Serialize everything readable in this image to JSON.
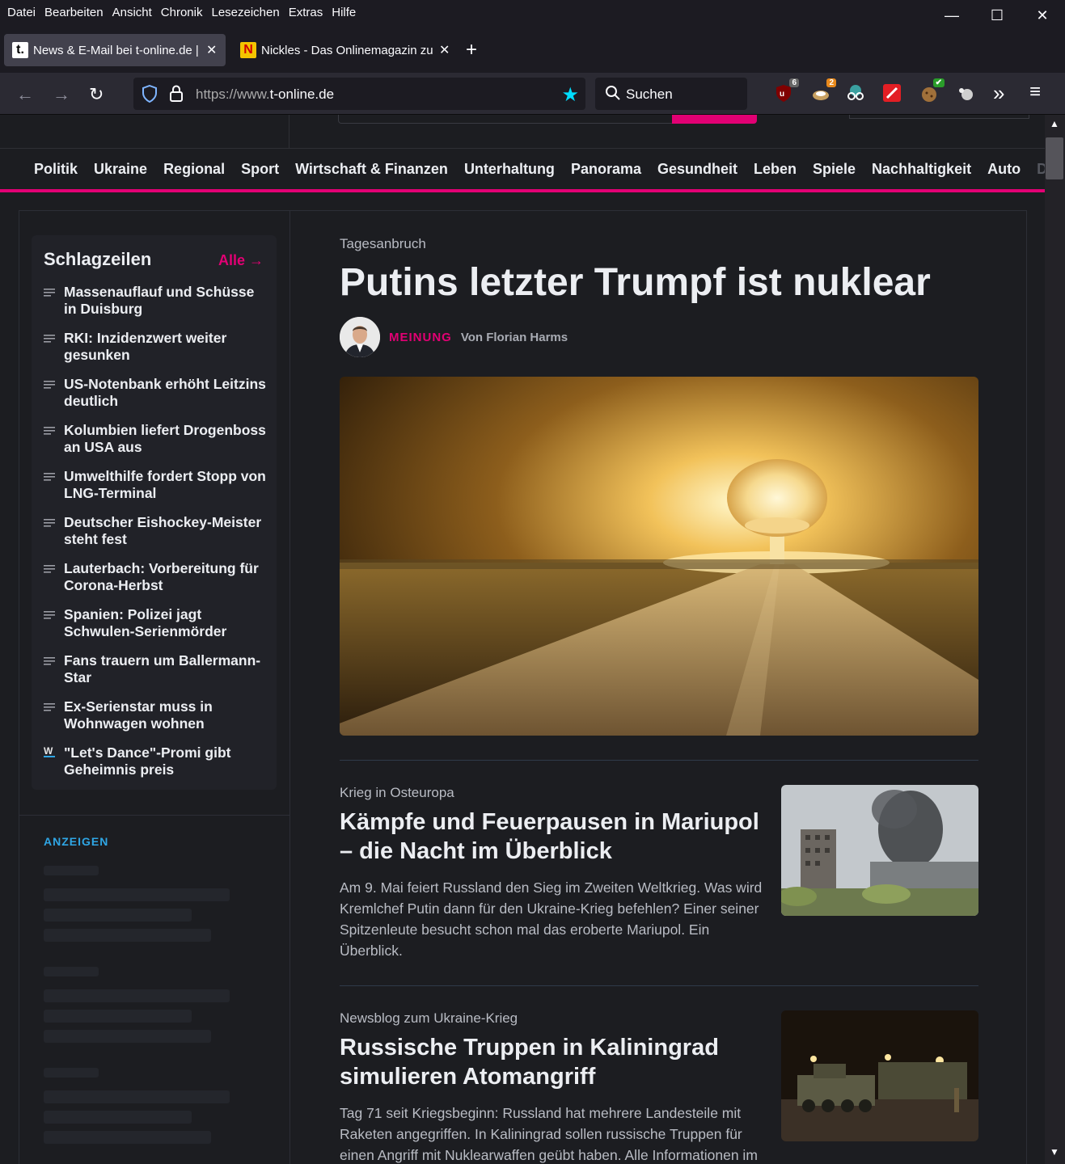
{
  "menubar": {
    "items": [
      "Datei",
      "Bearbeiten",
      "Ansicht",
      "Chronik",
      "Lesezeichen",
      "Extras",
      "Hilfe"
    ]
  },
  "window_controls": {
    "minimize": "—",
    "maximize": "☐",
    "close": "✕"
  },
  "tabs": [
    {
      "title": "News & E-Mail bei t-online.de | ",
      "favicon_text": "t.",
      "active": true
    },
    {
      "title": "Nickles - Das Onlinemagazin zu",
      "favicon_text": "N",
      "active": false
    }
  ],
  "newtab_label": "+",
  "navbar": {
    "back": "←",
    "forward": "→",
    "reload": "↻",
    "url_prefix": "https://www.",
    "url_domain": "t-online.de",
    "bookmark_star": "★",
    "search_placeholder": "Suchen",
    "extensions": [
      {
        "name": "ublock-icon",
        "badge": "6",
        "color": "#800000"
      },
      {
        "name": "download-ext-icon",
        "badge": "2",
        "color": "#c8a060"
      },
      {
        "name": "privacy-glasses-icon",
        "badge": "",
        "color": "#3aa0a0"
      },
      {
        "name": "pen-ext-icon",
        "badge": "",
        "color": "#e31e24"
      },
      {
        "name": "cookie-ext-icon",
        "badge": "✔",
        "color": "#a0703a"
      },
      {
        "name": "puzzle-ext-icon",
        "badge": "",
        "color": "#cfcfcf"
      }
    ],
    "overflow": "»",
    "menu": "≡"
  },
  "catnav": {
    "items": [
      "Politik",
      "Ukraine",
      "Regional",
      "Sport",
      "Wirtschaft & Finanzen",
      "Unterhaltung",
      "Panorama",
      "Gesundheit",
      "Leben",
      "Spiele",
      "Nachhaltigkeit",
      "Auto",
      "Di"
    ],
    "more": "›"
  },
  "headlines": {
    "title": "Schlagzeilen",
    "all_label": "Alle →",
    "items": [
      {
        "text": "Massenauflauf und Schüsse in Duisburg",
        "icon": "text-lines-icon"
      },
      {
        "text": "RKI: Inzidenzwert weiter gesunken",
        "icon": "text-lines-icon"
      },
      {
        "text": "US-Notenbank erhöht Leitzins deutlich",
        "icon": "text-lines-icon"
      },
      {
        "text": "Kolumbien liefert Drogenboss an USA aus",
        "icon": "text-lines-icon"
      },
      {
        "text": "Umwelthilfe fordert Stopp von LNG-Terminal",
        "icon": "text-lines-icon"
      },
      {
        "text": "Deutscher Eishockey-Meister steht fest",
        "icon": "text-lines-icon"
      },
      {
        "text": "Lauterbach: Vorbereitung für Corona-Herbst",
        "icon": "text-lines-icon"
      },
      {
        "text": "Spanien: Polizei jagt Schwulen-Serienmörder",
        "icon": "text-lines-icon"
      },
      {
        "text": "Fans trauern um Ballermann-Star",
        "icon": "text-lines-icon"
      },
      {
        "text": "Ex-Serienstar muss in Wohnwagen wohnen",
        "icon": "text-lines-icon"
      },
      {
        "text": "\"Let's Dance\"-Promi gibt Geheimnis preis",
        "icon": "w-video-icon"
      }
    ]
  },
  "ads_label": "ANZEIGEN",
  "lead": {
    "kicker": "Tagesanbruch",
    "title": "Putins letzter Trumpf ist nuklear",
    "label": "MEINUNG",
    "author": "Von Florian Harms"
  },
  "articles": [
    {
      "kicker": "Krieg in Osteuropa",
      "title": "Kämpfe und Feuerpausen in Mariupol – die Nacht im Überblick",
      "teaser": "Am 9. Mai feiert Russland den Sieg im Zweiten Weltkrieg. Was wird Kremlchef Putin dann für den Ukraine-Krieg befehlen? Einer seiner Spitzenleute besucht schon mal das eroberte Mariupol. Ein Überblick."
    },
    {
      "kicker": "Newsblog zum Ukraine-Krieg",
      "title": "Russische Truppen in Kaliningrad simulieren Atomangriff",
      "teaser": "Tag 71 seit Kriegsbeginn: Russland hat mehrere Landesteile mit Raketen angegriffen. In Kaliningrad sollen russische Truppen für einen Angriff mit Nuklearwaffen geübt haben. Alle Informationen im"
    }
  ],
  "colors": {
    "brand_magenta": "#e20074",
    "ads_blue": "#2fa6e5",
    "firefox_star": "#00ddff"
  }
}
